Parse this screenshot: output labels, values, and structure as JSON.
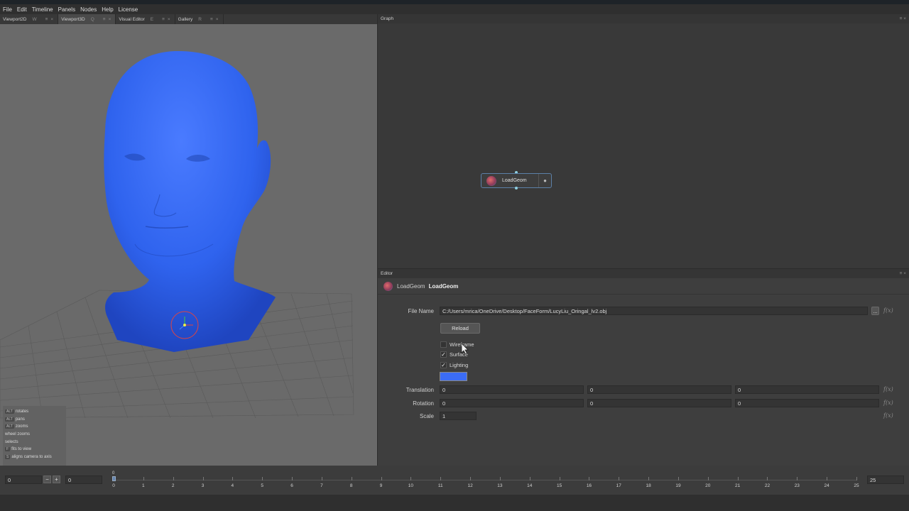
{
  "menu": [
    "File",
    "Edit",
    "Timeline",
    "Panels",
    "Nodes",
    "Help",
    "License"
  ],
  "left_tabs": [
    {
      "label": "Viewport2D",
      "shortcut": "W"
    },
    {
      "label": "Viewport3D",
      "shortcut": "Q"
    },
    {
      "label": "Visual Editor",
      "shortcut": "E"
    },
    {
      "label": "Gallery",
      "shortcut": "R"
    }
  ],
  "viewport_help": [
    {
      "key": "ALT",
      "text": "rotates"
    },
    {
      "key": "ALT",
      "text": "pans"
    },
    {
      "key": "ALT",
      "text": "zooms"
    },
    {
      "key": "",
      "text": "wheel zooms"
    },
    {
      "key": "",
      "text": "selects"
    },
    {
      "key": "F",
      "text": "fits to view"
    },
    {
      "key": "S",
      "text": "aligns camera to axis"
    }
  ],
  "graph": {
    "title": "Graph",
    "node_label": "LoadGeom"
  },
  "editor": {
    "title": "Editor",
    "node_type": "LoadGeom",
    "node_name": "LoadGeom",
    "file_name_label": "File Name",
    "file_name_value": "C:/Users/mrica/OneDrive/Desktop/FaceForm/LucyLiu_Oringal_lv2.obj",
    "browse_label": "...",
    "reload_label": "Reload",
    "wireframe_label": "Wireframe",
    "wireframe_checked": false,
    "surface_label": "Surface",
    "surface_checked": true,
    "lighting_label": "Lighting",
    "lighting_checked": true,
    "surface_color": "#3b6cf5",
    "translation_label": "Translation",
    "translation": [
      "0",
      "0",
      "0"
    ],
    "rotation_label": "Rotation",
    "rotation": [
      "0",
      "0",
      "0"
    ],
    "scale_label": "Scale",
    "scale": "1",
    "fx_label": "f(x)"
  },
  "timeline": {
    "current": "0",
    "offset": "0",
    "end": "25",
    "marker": "0",
    "ticks": [
      "0",
      "1",
      "2",
      "3",
      "4",
      "5",
      "6",
      "7",
      "8",
      "9",
      "10",
      "11",
      "12",
      "13",
      "14",
      "15",
      "16",
      "17",
      "18",
      "19",
      "20",
      "21",
      "22",
      "23",
      "24",
      "25"
    ]
  },
  "colors": {
    "mesh": "#2f63ee",
    "accent": "#5c80a8"
  }
}
